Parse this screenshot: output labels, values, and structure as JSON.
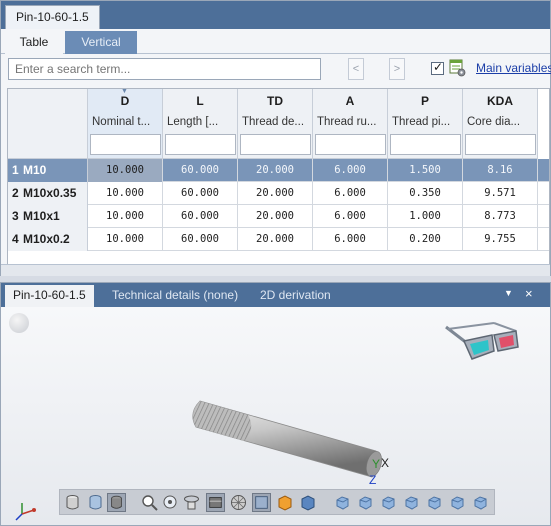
{
  "document_tab": "Pin-10-60-1.5",
  "view_tabs": [
    {
      "label": "Table",
      "active": true
    },
    {
      "label": "Vertical",
      "active": false
    }
  ],
  "search": {
    "placeholder": "Enter a search term...",
    "value": ""
  },
  "nav": {
    "prev": "<",
    "next": ">"
  },
  "main_variables": {
    "checked": true,
    "label": "Main variables"
  },
  "columns": [
    {
      "code": "D",
      "desc": "Nominal t..."
    },
    {
      "code": "L",
      "desc": "Length [..."
    },
    {
      "code": "TD",
      "desc": "Thread de..."
    },
    {
      "code": "A",
      "desc": "Thread ru..."
    },
    {
      "code": "P",
      "desc": "Thread pi..."
    },
    {
      "code": "KDA",
      "desc": "Core dia..."
    }
  ],
  "rows": [
    {
      "num": "1",
      "name": "M10",
      "selected": true,
      "values": [
        "10.000",
        "60.000",
        "20.000",
        "6.000",
        "1.500",
        "8.16"
      ]
    },
    {
      "num": "2",
      "name": "M10x0.35",
      "selected": false,
      "values": [
        "10.000",
        "60.000",
        "20.000",
        "6.000",
        "0.350",
        "9.571"
      ]
    },
    {
      "num": "3",
      "name": "M10x1",
      "selected": false,
      "values": [
        "10.000",
        "60.000",
        "20.000",
        "6.000",
        "1.000",
        "8.773"
      ]
    },
    {
      "num": "4",
      "name": "M10x0.2",
      "selected": false,
      "values": [
        "10.000",
        "60.000",
        "20.000",
        "6.000",
        "0.200",
        "9.755"
      ]
    }
  ],
  "bottom_tabs": [
    {
      "label": "Pin-10-60-1.5",
      "active": true
    },
    {
      "label": "Technical details (none)",
      "active": false
    },
    {
      "label": "2D derivation",
      "active": false
    }
  ],
  "panel_controls": {
    "menu": "▼",
    "close": "×"
  },
  "axes": {
    "x": "X",
    "y": "Y",
    "z": "Z"
  },
  "toolbar_icons": [
    "solid-view-icon",
    "wireframe-view-icon",
    "shaded-view-icon",
    "zoom-icon",
    "zoom-window-icon",
    "rotate-icon",
    "box-select-icon",
    "mesh-icon",
    "section-icon",
    "color-icon",
    "box-icon",
    "view-front-icon",
    "view-back-icon",
    "view-left-icon",
    "view-right-icon",
    "view-top-icon",
    "view-bottom-icon",
    "view-iso-icon"
  ],
  "colors": {
    "tab_bar": "#4d6f99",
    "selected_row": "#7a95b8",
    "link": "#1b3ea8"
  }
}
